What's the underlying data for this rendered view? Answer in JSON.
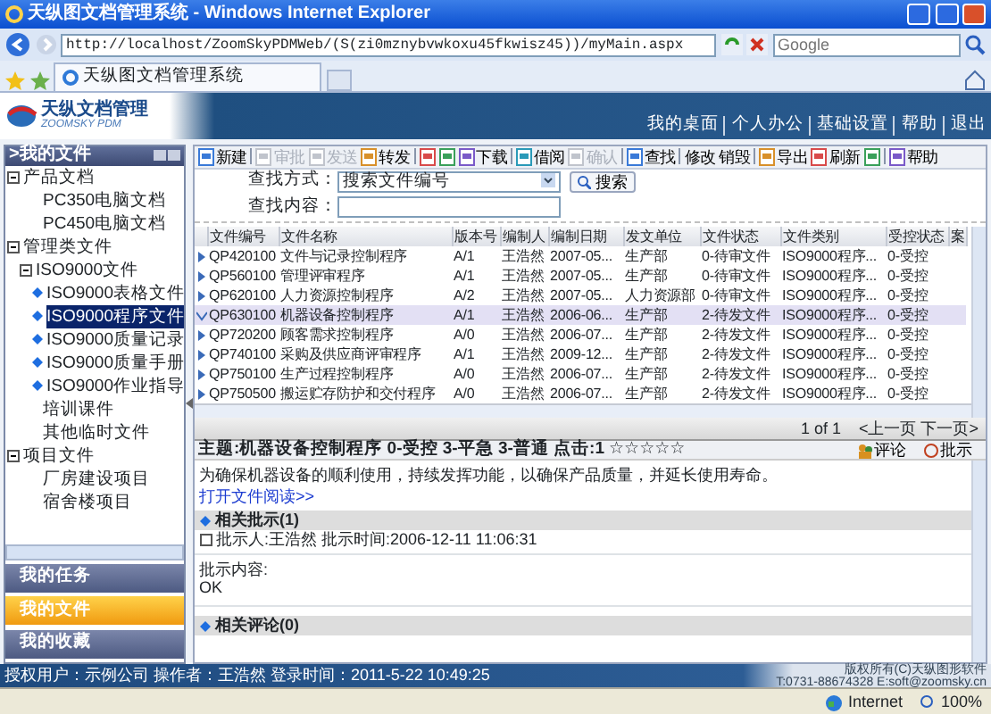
{
  "window": {
    "title": "天纵图文档管理系统 - Windows Internet Explorer"
  },
  "browser": {
    "address": "http://localhost/ZoomSkyPDMWeb/(S(zi0mznybvwkoxu45fkwisz45))/myMain.aspx",
    "search_placeholder": "Google",
    "tab": "天纵图文档管理系统",
    "zone": "Internet",
    "zoom": "100%"
  },
  "app": {
    "logo": "天纵文档管理",
    "logo_sub": "ZOOMSKY PDM",
    "nav": [
      "我的桌面",
      "个人办公",
      "基础设置",
      "帮助",
      "退出"
    ]
  },
  "sidebar": {
    "title": ">我的文件",
    "tree": [
      {
        "label": "产品文档",
        "expanded": true,
        "selected": false,
        "children": [
          {
            "label": "PC350电脑文档",
            "selected": false
          },
          {
            "label": "PC450电脑文档",
            "selected": false
          }
        ]
      },
      {
        "label": "管理类文件",
        "expanded": true,
        "selected": false,
        "children": [
          {
            "label": "ISO9000文件",
            "expanded": true,
            "selected": false,
            "children": [
              {
                "label": "ISO9000表格文件",
                "selected": false
              },
              {
                "label": "ISO9000程序文件",
                "selected": true
              },
              {
                "label": "ISO9000质量记录",
                "selected": false
              },
              {
                "label": "ISO9000质量手册",
                "selected": false
              },
              {
                "label": "ISO9000作业指导",
                "selected": false
              }
            ]
          },
          {
            "label": "培训课件",
            "selected": false
          },
          {
            "label": "其他临时文件",
            "selected": false
          }
        ]
      },
      {
        "label": "项目文件",
        "expanded": true,
        "selected": false,
        "children": [
          {
            "label": "厂房建设项目",
            "selected": false
          },
          {
            "label": "宿舍楼项目",
            "selected": false
          }
        ]
      }
    ],
    "buttons": [
      {
        "label": "我的任务",
        "selected": false
      },
      {
        "label": "我的文件",
        "selected": true
      },
      {
        "label": "我的收藏",
        "selected": false
      }
    ]
  },
  "toolbar": [
    [
      {
        "label": "新建",
        "disabled": false
      }
    ],
    [
      {
        "label": "审批",
        "disabled": true
      },
      {
        "label": "发送",
        "disabled": true
      },
      {
        "label": "转发",
        "disabled": false
      }
    ],
    [
      {
        "disabled": false
      },
      {
        "disabled": false
      },
      {
        "label": "下载",
        "disabled": false
      }
    ],
    [
      {
        "label": "借阅",
        "disabled": false
      },
      {
        "label": "确认",
        "disabled": true
      }
    ],
    [
      {
        "label": "查找",
        "disabled": false
      }
    ],
    [
      {
        "label": "修改",
        "disabled": false,
        "kind": "text"
      },
      {
        "label": "销毁",
        "disabled": false,
        "kind": "text"
      }
    ],
    [
      {
        "label": "导出",
        "disabled": false
      },
      {
        "label": "刷新",
        "disabled": false
      },
      {
        "disabled": false
      }
    ],
    [
      {
        "label": "帮助",
        "disabled": false
      }
    ]
  ],
  "search": {
    "fields": [
      {
        "label": "查找方式：",
        "kind": "select",
        "value": "搜索文件编号"
      },
      {
        "label": "查找内容：",
        "kind": "text"
      }
    ],
    "button": "搜索"
  },
  "table": {
    "columns": [
      "文件编号",
      "文件名称",
      "版本号",
      "编制人",
      "编制日期",
      "发文单位",
      "文件状态",
      "文件类别",
      "受控状态",
      "案"
    ],
    "rows": [
      {
        "selected": false,
        "cells": [
          "QP420100",
          "文件与记录控制程序",
          "A/1",
          "王浩然",
          "2007-05...",
          "生产部",
          "0-待审文件",
          "ISO9000程序...",
          "0-受控"
        ]
      },
      {
        "selected": false,
        "cells": [
          "QP560100",
          "管理评审程序",
          "A/1",
          "王浩然",
          "2007-05...",
          "生产部",
          "0-待审文件",
          "ISO9000程序...",
          "0-受控"
        ]
      },
      {
        "selected": false,
        "cells": [
          "QP620100",
          "人力资源控制程序",
          "A/2",
          "王浩然",
          "2007-05...",
          "人力资源部",
          "0-待审文件",
          "ISO9000程序...",
          "0-受控"
        ]
      },
      {
        "selected": true,
        "cells": [
          "QP630100",
          "机器设备控制程序",
          "A/1",
          "王浩然",
          "2006-06...",
          "生产部",
          "2-待发文件",
          "ISO9000程序...",
          "0-受控"
        ]
      },
      {
        "selected": false,
        "cells": [
          "QP720200",
          "顾客需求控制程序",
          "A/0",
          "王浩然",
          "2006-07...",
          "生产部",
          "2-待发文件",
          "ISO9000程序...",
          "0-受控"
        ]
      },
      {
        "selected": false,
        "cells": [
          "QP740100",
          "采购及供应商评审程序",
          "A/1",
          "王浩然",
          "2009-12...",
          "生产部",
          "2-待发文件",
          "ISO9000程序...",
          "0-受控"
        ]
      },
      {
        "selected": false,
        "cells": [
          "QP750100",
          "生产过程控制程序",
          "A/0",
          "王浩然",
          "2006-07...",
          "生产部",
          "2-待发文件",
          "ISO9000程序...",
          "0-受控"
        ]
      },
      {
        "selected": false,
        "cells": [
          "QP750500",
          "搬运贮存防护和交付程序",
          "A/0",
          "王浩然",
          "2006-07...",
          "生产部",
          "2-待发文件",
          "ISO9000程序...",
          "0-受控"
        ]
      }
    ]
  },
  "pager": {
    "info": "1 of 1",
    "prev": "<上一页",
    "next": "下一页>"
  },
  "detail": {
    "title": "主题:机器设备控制程序 0-受控 3-平急 3-普通 点击:1",
    "stars": 0,
    "actions": [
      "评论",
      "批示"
    ],
    "description": "为确保机器设备的顺利使用，持续发挥功能，以确保产品质量，并延长使用寿命。",
    "link": "打开文件阅读>>",
    "sections": [
      {
        "title": "相关批示(1)",
        "entries": [
          {
            "meta": "批示人:王浩然 批示时间:2006-12-11 11:06:31",
            "label": "批示内容:",
            "content": "OK"
          }
        ]
      },
      {
        "title": "相关评论(0)"
      }
    ]
  },
  "footer": {
    "info": "授权用户：示例公司 操作者：王浩然 登录时间：2011-5-22 10:49:25",
    "copyright": "版权所有(C)天纵图形软件",
    "contact": "T:0731-88674328 E:soft@zoomsky.cn"
  }
}
